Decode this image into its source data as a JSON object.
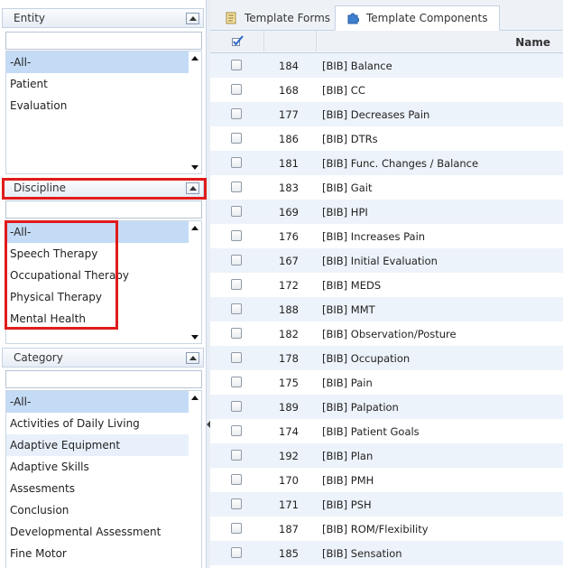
{
  "entity": {
    "title": "Entity",
    "filter_value": "",
    "items": [
      {
        "label": "-All-",
        "selected": true
      },
      {
        "label": "Patient"
      },
      {
        "label": "Evaluation"
      }
    ]
  },
  "discipline": {
    "title": "Discipline",
    "filter_value": "",
    "items": [
      {
        "label": "-All-",
        "selected": true
      },
      {
        "label": "Speech Therapy"
      },
      {
        "label": "Occupational Therapy"
      },
      {
        "label": "Physical Therapy"
      },
      {
        "label": "Mental Health"
      }
    ]
  },
  "category": {
    "title": "Category",
    "filter_value": "",
    "items": [
      {
        "label": "-All-",
        "selected": true
      },
      {
        "label": "Activities of Daily Living"
      },
      {
        "label": "Adaptive Equipment",
        "hover": true
      },
      {
        "label": "Adaptive Skills"
      },
      {
        "label": "Assesments"
      },
      {
        "label": "Conclusion"
      },
      {
        "label": "Developmental Assessment"
      },
      {
        "label": "Fine Motor"
      }
    ]
  },
  "tabs": [
    {
      "label": "Template Forms",
      "active": false,
      "icon": "form-icon"
    },
    {
      "label": "Template Components",
      "active": true,
      "icon": "puzzle-icon"
    }
  ],
  "grid": {
    "header": {
      "check_icon": "check-all-icon",
      "name_label": "Name"
    },
    "rows": [
      {
        "id": "184",
        "name": "[BIB] Balance"
      },
      {
        "id": "168",
        "name": "[BIB] CC"
      },
      {
        "id": "177",
        "name": "[BIB] Decreases Pain"
      },
      {
        "id": "186",
        "name": "[BIB] DTRs"
      },
      {
        "id": "181",
        "name": "[BIB] Func. Changes / Balance"
      },
      {
        "id": "183",
        "name": "[BIB] Gait"
      },
      {
        "id": "169",
        "name": "[BIB] HPI"
      },
      {
        "id": "176",
        "name": "[BIB] Increases Pain"
      },
      {
        "id": "167",
        "name": "[BIB] Initial Evaluation"
      },
      {
        "id": "172",
        "name": "[BIB] MEDS"
      },
      {
        "id": "188",
        "name": "[BIB] MMT"
      },
      {
        "id": "182",
        "name": "[BIB] Observation/Posture"
      },
      {
        "id": "178",
        "name": "[BIB] Occupation"
      },
      {
        "id": "175",
        "name": "[BIB] Pain"
      },
      {
        "id": "189",
        "name": "[BIB] Palpation"
      },
      {
        "id": "174",
        "name": "[BIB] Patient Goals"
      },
      {
        "id": "192",
        "name": "[BIB] Plan"
      },
      {
        "id": "170",
        "name": "[BIB] PMH"
      },
      {
        "id": "171",
        "name": "[BIB] PSH"
      },
      {
        "id": "187",
        "name": "[BIB] ROM/Flexibility"
      },
      {
        "id": "185",
        "name": "[BIB] Sensation"
      }
    ]
  },
  "colors": {
    "selection": "#c4dbf5",
    "alt_row": "#edf3fa",
    "highlight": "#e01b1b"
  }
}
